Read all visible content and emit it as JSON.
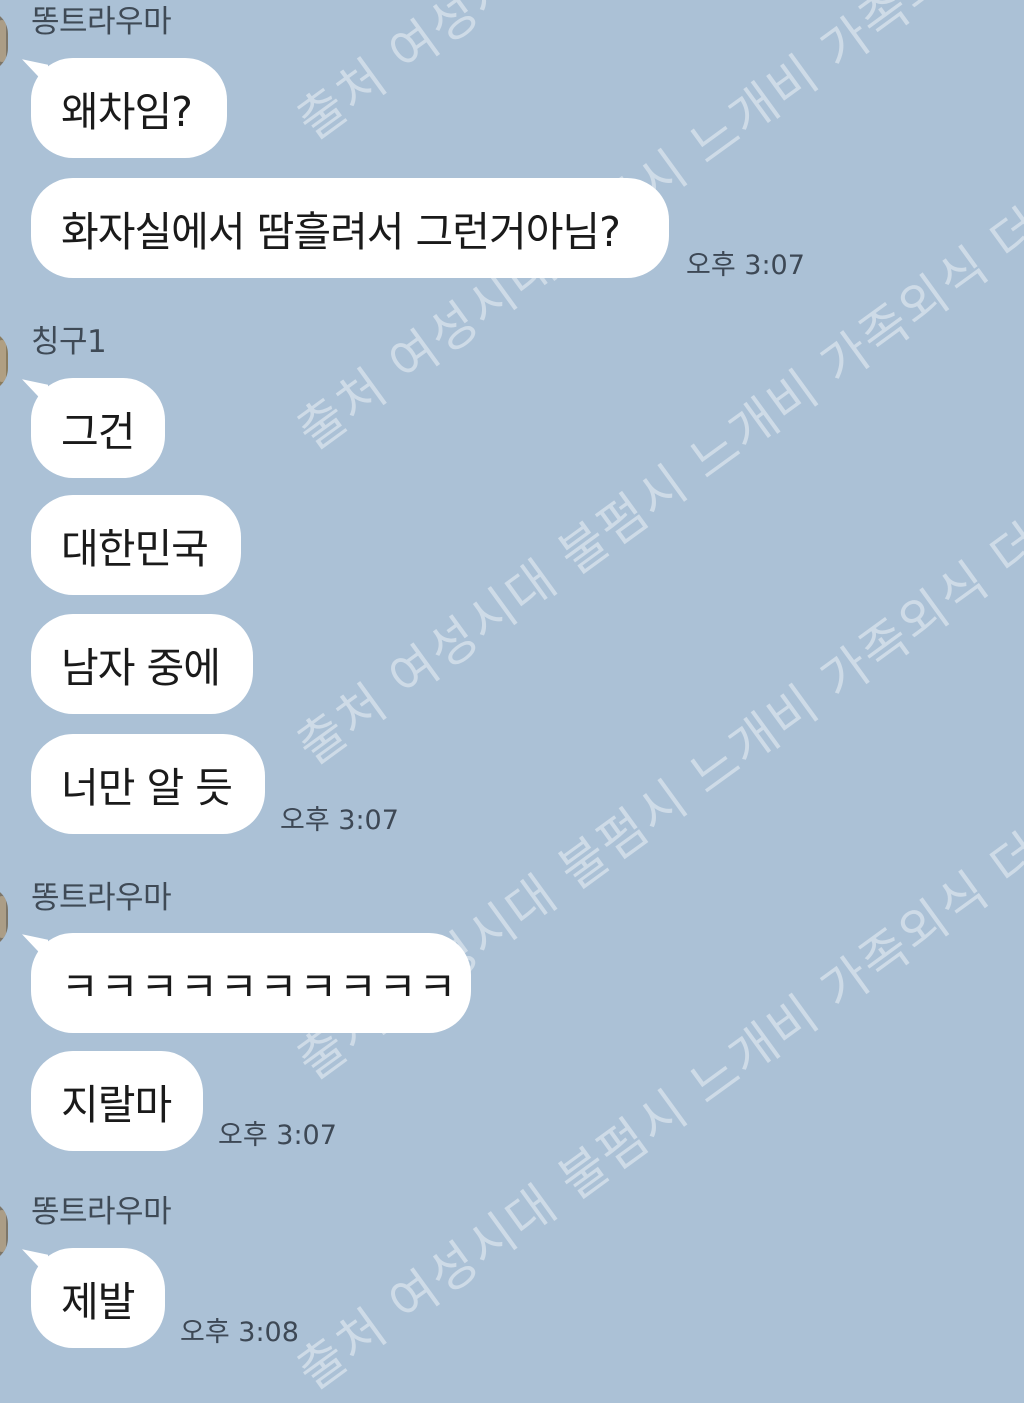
{
  "colors": {
    "background": "#abc1d6",
    "bubble": "#ffffff",
    "text": "#1a1a1a",
    "meta_text": "#3d4855"
  },
  "groups": [
    {
      "sender": "똥트라우마",
      "messages": [
        "왜차임?",
        "화자실에서 땀흘려서 그런거아님?"
      ],
      "time": "오후 3:07"
    },
    {
      "sender": "칭구1",
      "messages": [
        "그건",
        "대한민국",
        "남자 중에",
        "너만 알 듯"
      ],
      "time": "오후 3:07"
    },
    {
      "sender": "똥트라우마",
      "messages": [
        "ㅋㅋㅋㅋㅋㅋㅋㅋㅋㅋ",
        "지랄마"
      ],
      "time": "오후 3:07"
    },
    {
      "sender": "똥트라우마",
      "messages": [
        "제발"
      ],
      "time": "오후 3:08"
    }
  ],
  "watermark": "출처 여성시대 불펌시 느개비 가족외식 더치페이"
}
